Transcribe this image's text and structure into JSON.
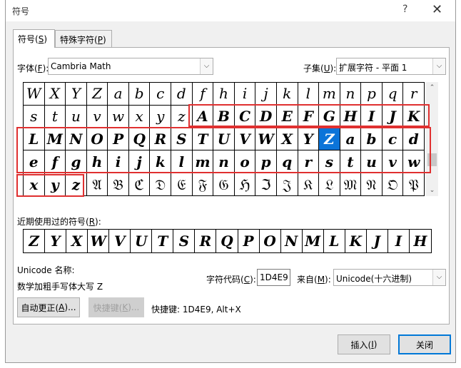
{
  "title": "符号",
  "title_buttons": {
    "help": "?",
    "close": "✕"
  },
  "tabs": [
    {
      "label": "符号(",
      "key": "S",
      "suffix": ")"
    },
    {
      "label": "特殊字符(",
      "key": "P",
      "suffix": ")"
    }
  ],
  "font": {
    "label_pre": "字体(",
    "key": "F",
    "label_post": "):",
    "value": "Cambria Math"
  },
  "subset": {
    "label_pre": "子集(",
    "key": "U",
    "label_post": "):",
    "value": "扩展字符 - 平面 1"
  },
  "grid_rows": [
    [
      "W",
      "X",
      "Y",
      "Z",
      "a",
      "b",
      "c",
      "d",
      "f",
      "h",
      "i",
      "j",
      "k",
      "l",
      "m",
      "n",
      "p",
      "q",
      "r"
    ],
    [
      "s",
      "t",
      "u",
      "v",
      "w",
      "x",
      "y",
      "z",
      "A",
      "B",
      "C",
      "D",
      "E",
      "F",
      "G",
      "H",
      "I",
      "J",
      "K"
    ],
    [
      "L",
      "M",
      "N",
      "O",
      "P",
      "Q",
      "R",
      "S",
      "T",
      "U",
      "V",
      "W",
      "X",
      "Y",
      "Z",
      "a",
      "b",
      "c",
      "d"
    ],
    [
      "e",
      "f",
      "g",
      "h",
      "i",
      "j",
      "k",
      "l",
      "m",
      "n",
      "o",
      "p",
      "q",
      "r",
      "s",
      "t",
      "u",
      "v",
      "w"
    ],
    [
      "x",
      "y",
      "z",
      "𝔄",
      "𝔅",
      "ℭ",
      "𝔇",
      "𝔈",
      "𝔉",
      "𝔊",
      "ℌ",
      "ℑ",
      "𝔍",
      "𝔎",
      "𝔏",
      "𝔐",
      "𝔑",
      "𝔒",
      "𝔓"
    ]
  ],
  "selected_symbol": "Z",
  "recent": {
    "label_pre": "近期使用过的符号(",
    "key": "R",
    "label_post": "):",
    "symbols": [
      "Z",
      "Y",
      "X",
      "W",
      "V",
      "U",
      "T",
      "S",
      "R",
      "Q",
      "P",
      "O",
      "N",
      "M",
      "L",
      "K",
      "J",
      "I",
      "H"
    ]
  },
  "unicode_name_label": "Unicode 名称:",
  "unicode_name_value": "数学加粗手写体大写 Z",
  "char_code": {
    "label_pre": "字符代码(",
    "key": "C",
    "label_post": "):",
    "value": "1D4E9"
  },
  "from": {
    "label_pre": "来自(",
    "key": "M",
    "label_post": "):",
    "value": "Unicode(十六进制)"
  },
  "buttons": {
    "autocorrect": {
      "pre": "自动更正(",
      "key": "A",
      "post": ")..."
    },
    "shortcut": {
      "pre": "快捷键(",
      "key": "K",
      "post": ")..."
    },
    "shortcut_text": "快捷键: 1D4E9, Alt+X",
    "insert": {
      "pre": "插入(",
      "key": "I",
      "post": ")"
    },
    "close": "关闭"
  },
  "colors": {
    "selection": "#0b74d9",
    "highlight_box": "#e03030",
    "primary_border": "#0078d7"
  }
}
